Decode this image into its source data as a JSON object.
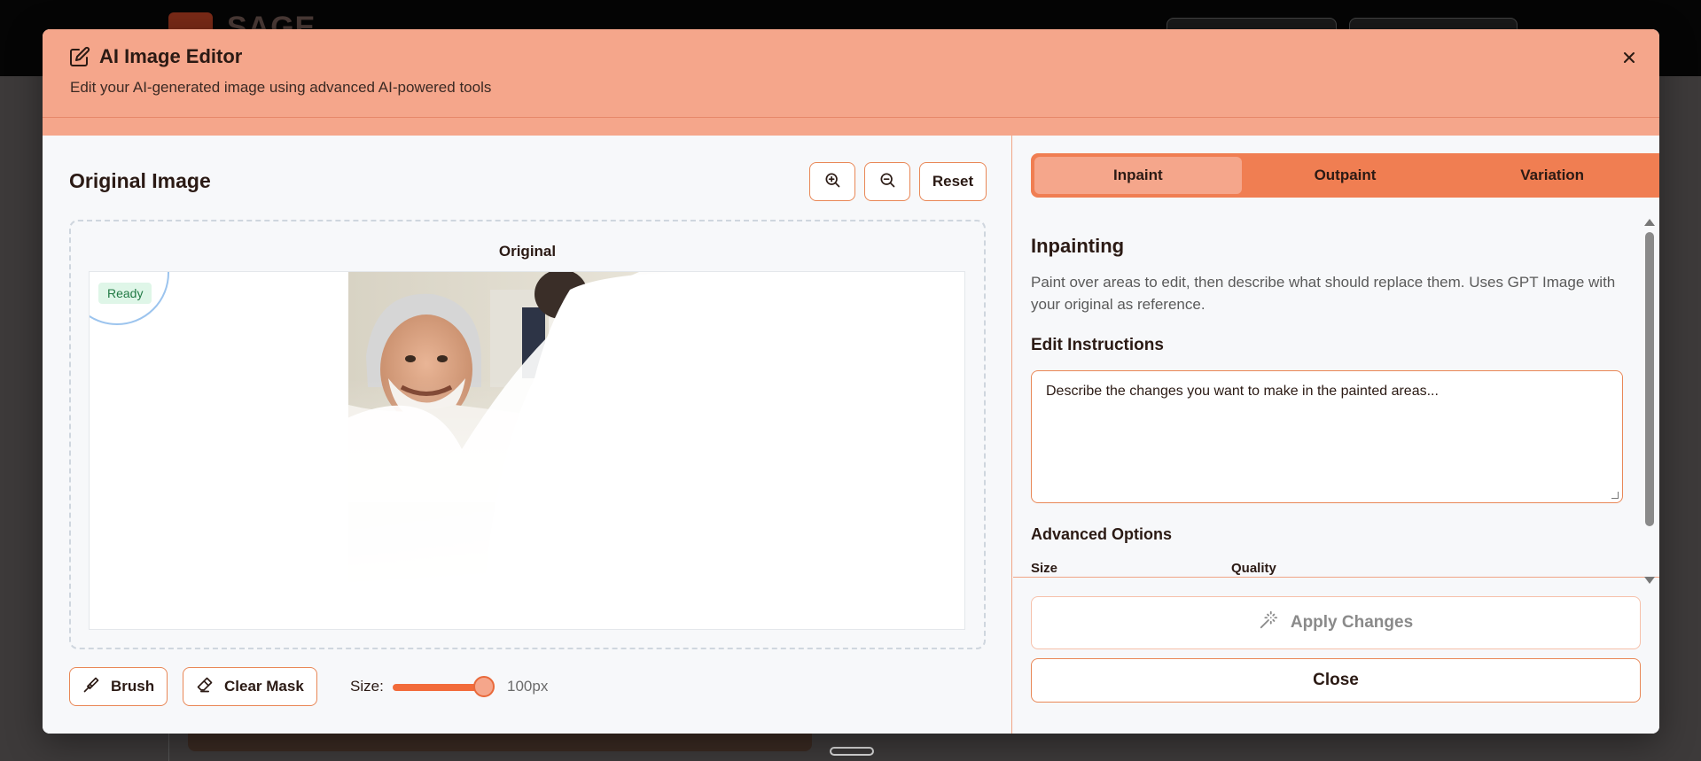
{
  "background": {
    "logo_text": "SAGE"
  },
  "modal": {
    "title": "AI Image Editor",
    "subtitle": "Edit your AI-generated image using advanced AI-powered tools",
    "close_icon": "close-icon"
  },
  "left": {
    "title": "Original Image",
    "zoom_in_icon": "zoom-in-icon",
    "zoom_out_icon": "zoom-out-icon",
    "reset_label": "Reset",
    "canvas_label": "Original",
    "status_badge": "Ready",
    "tools": {
      "brush_label": "Brush",
      "clear_mask_label": "Clear Mask",
      "size_label": "Size:",
      "size_value": "100px",
      "slider_fraction": 0.8
    }
  },
  "right": {
    "tabs": [
      {
        "label": "Inpaint",
        "active": true
      },
      {
        "label": "Outpaint",
        "active": false
      },
      {
        "label": "Variation",
        "active": false
      }
    ],
    "section_title": "Inpainting",
    "section_desc": "Paint over areas to edit, then describe what should replace them. Uses GPT Image with your original as reference.",
    "instructions_label": "Edit Instructions",
    "instructions_placeholder": "Describe the changes you want to make in the painted areas...",
    "advanced_label": "Advanced Options",
    "option_size_label": "Size",
    "option_quality_label": "Quality",
    "apply_label": "Apply Changes",
    "close_label": "Close"
  },
  "colors": {
    "header": "#f5a68b",
    "accent": "#e98756",
    "tab_bar": "#f07e52"
  }
}
